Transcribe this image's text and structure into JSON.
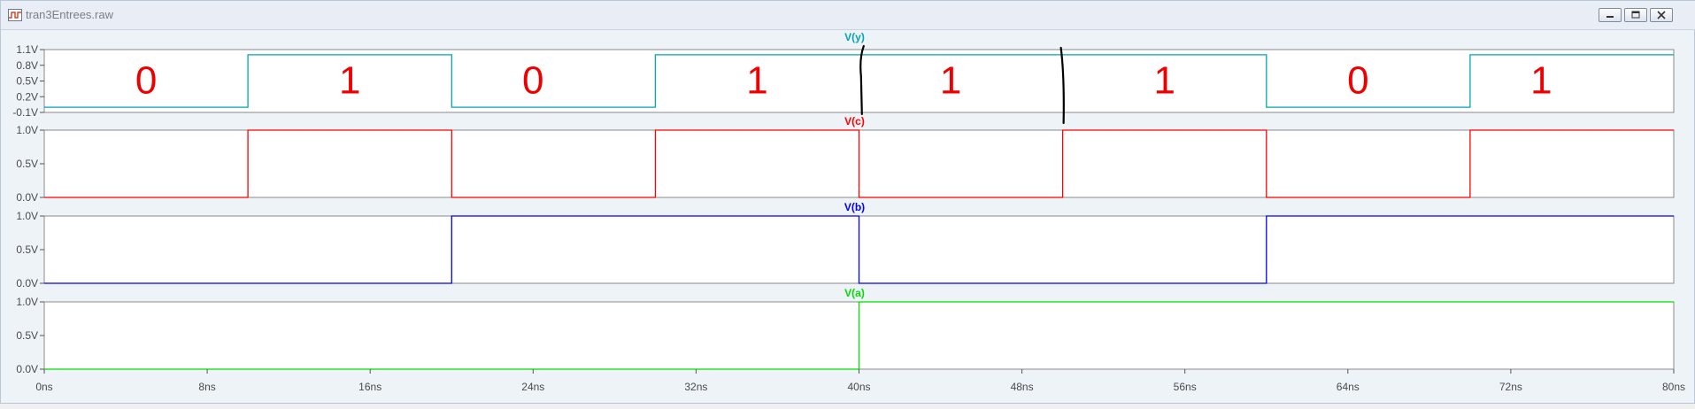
{
  "window": {
    "title": "tran3Entrees.raw",
    "icon": "waveform-icon",
    "controls": [
      "minimize-icon",
      "restore-icon",
      "close-icon"
    ]
  },
  "chart_data": {
    "type": "line",
    "subtype": "digital-waveform",
    "x_unit": "ns",
    "xlim": [
      0,
      80
    ],
    "x_ticks": [
      "0ns",
      "8ns",
      "16ns",
      "24ns",
      "32ns",
      "40ns",
      "48ns",
      "56ns",
      "64ns",
      "72ns",
      "80ns"
    ],
    "x_tick_values": [
      0,
      8,
      16,
      24,
      32,
      40,
      48,
      56,
      64,
      72,
      80
    ],
    "panes": [
      {
        "name": "V(y)",
        "color": "#00a6b2",
        "ylim": [
          -0.1,
          1.1
        ],
        "y_ticks": [
          "1.1V",
          "0.8V",
          "0.5V",
          "0.2V",
          "-0.1V"
        ],
        "y_tick_values": [
          1.1,
          0.8,
          0.5,
          0.2,
          -0.1
        ],
        "x": [
          0,
          10,
          10,
          20,
          20,
          30,
          30,
          60,
          60,
          70,
          70,
          80
        ],
        "y": [
          0,
          0,
          1,
          1,
          0,
          0,
          1,
          1,
          0,
          0,
          1,
          1
        ]
      },
      {
        "name": "V(c)",
        "color": "#ff0000",
        "ylim": [
          0,
          1
        ],
        "y_ticks": [
          "1.0V",
          "0.5V",
          "0.0V"
        ],
        "y_tick_values": [
          1,
          0.5,
          0
        ],
        "x": [
          0,
          10,
          10,
          20,
          20,
          30,
          30,
          40,
          40,
          50,
          50,
          60,
          60,
          70,
          70,
          80
        ],
        "y": [
          0,
          0,
          1,
          1,
          0,
          0,
          1,
          1,
          0,
          0,
          1,
          1,
          0,
          0,
          1,
          1
        ]
      },
      {
        "name": "V(b)",
        "color": "#0000ff",
        "ylim": [
          0,
          1
        ],
        "y_ticks": [
          "1.0V",
          "0.5V",
          "0.0V"
        ],
        "y_tick_values": [
          1,
          0.5,
          0
        ],
        "x": [
          0,
          20,
          20,
          40,
          40,
          60,
          60,
          80
        ],
        "y": [
          0,
          0,
          1,
          1,
          0,
          0,
          1,
          1
        ]
      },
      {
        "name": "V(a)",
        "color": "#00dd00",
        "ylim": [
          0,
          1
        ],
        "y_ticks": [
          "1.0V",
          "0.5V",
          "0.0V"
        ],
        "y_tick_values": [
          1,
          0.5,
          0
        ],
        "x": [
          0,
          40,
          40,
          80
        ],
        "y": [
          0,
          0,
          1,
          1
        ]
      }
    ],
    "annotations": [
      {
        "text": "0",
        "x": 5
      },
      {
        "text": "1",
        "x": 15
      },
      {
        "text": "0",
        "x": 24
      },
      {
        "text": "1",
        "x": 35
      },
      {
        "text": "1",
        "x": 44.5
      },
      {
        "text": "1",
        "x": 55
      },
      {
        "text": "0",
        "x": 64.5
      },
      {
        "text": "1",
        "x": 73.5
      }
    ],
    "annotation_color": "#ee0000",
    "marker_lines_x": [
      40.1,
      50
    ]
  }
}
